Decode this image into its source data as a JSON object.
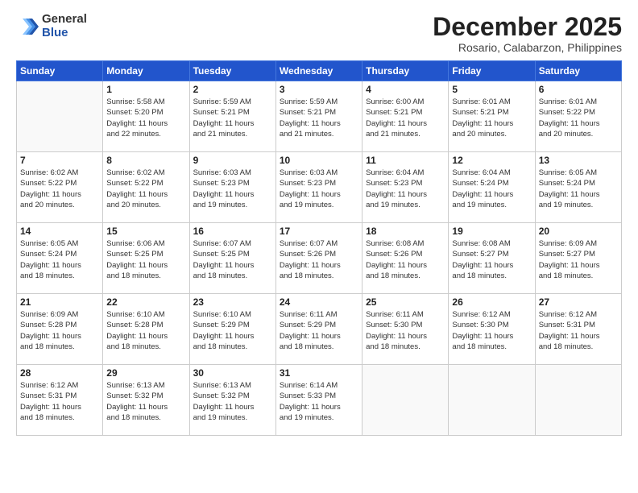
{
  "header": {
    "logo_general": "General",
    "logo_blue": "Blue",
    "month_title": "December 2025",
    "location": "Rosario, Calabarzon, Philippines"
  },
  "days_of_week": [
    "Sunday",
    "Monday",
    "Tuesday",
    "Wednesday",
    "Thursday",
    "Friday",
    "Saturday"
  ],
  "weeks": [
    [
      {
        "day": "",
        "content": ""
      },
      {
        "day": "1",
        "content": "Sunrise: 5:58 AM\nSunset: 5:20 PM\nDaylight: 11 hours\nand 22 minutes."
      },
      {
        "day": "2",
        "content": "Sunrise: 5:59 AM\nSunset: 5:21 PM\nDaylight: 11 hours\nand 21 minutes."
      },
      {
        "day": "3",
        "content": "Sunrise: 5:59 AM\nSunset: 5:21 PM\nDaylight: 11 hours\nand 21 minutes."
      },
      {
        "day": "4",
        "content": "Sunrise: 6:00 AM\nSunset: 5:21 PM\nDaylight: 11 hours\nand 21 minutes."
      },
      {
        "day": "5",
        "content": "Sunrise: 6:01 AM\nSunset: 5:21 PM\nDaylight: 11 hours\nand 20 minutes."
      },
      {
        "day": "6",
        "content": "Sunrise: 6:01 AM\nSunset: 5:22 PM\nDaylight: 11 hours\nand 20 minutes."
      }
    ],
    [
      {
        "day": "7",
        "content": "Sunrise: 6:02 AM\nSunset: 5:22 PM\nDaylight: 11 hours\nand 20 minutes."
      },
      {
        "day": "8",
        "content": "Sunrise: 6:02 AM\nSunset: 5:22 PM\nDaylight: 11 hours\nand 20 minutes."
      },
      {
        "day": "9",
        "content": "Sunrise: 6:03 AM\nSunset: 5:23 PM\nDaylight: 11 hours\nand 19 minutes."
      },
      {
        "day": "10",
        "content": "Sunrise: 6:03 AM\nSunset: 5:23 PM\nDaylight: 11 hours\nand 19 minutes."
      },
      {
        "day": "11",
        "content": "Sunrise: 6:04 AM\nSunset: 5:23 PM\nDaylight: 11 hours\nand 19 minutes."
      },
      {
        "day": "12",
        "content": "Sunrise: 6:04 AM\nSunset: 5:24 PM\nDaylight: 11 hours\nand 19 minutes."
      },
      {
        "day": "13",
        "content": "Sunrise: 6:05 AM\nSunset: 5:24 PM\nDaylight: 11 hours\nand 19 minutes."
      }
    ],
    [
      {
        "day": "14",
        "content": "Sunrise: 6:05 AM\nSunset: 5:24 PM\nDaylight: 11 hours\nand 18 minutes."
      },
      {
        "day": "15",
        "content": "Sunrise: 6:06 AM\nSunset: 5:25 PM\nDaylight: 11 hours\nand 18 minutes."
      },
      {
        "day": "16",
        "content": "Sunrise: 6:07 AM\nSunset: 5:25 PM\nDaylight: 11 hours\nand 18 minutes."
      },
      {
        "day": "17",
        "content": "Sunrise: 6:07 AM\nSunset: 5:26 PM\nDaylight: 11 hours\nand 18 minutes."
      },
      {
        "day": "18",
        "content": "Sunrise: 6:08 AM\nSunset: 5:26 PM\nDaylight: 11 hours\nand 18 minutes."
      },
      {
        "day": "19",
        "content": "Sunrise: 6:08 AM\nSunset: 5:27 PM\nDaylight: 11 hours\nand 18 minutes."
      },
      {
        "day": "20",
        "content": "Sunrise: 6:09 AM\nSunset: 5:27 PM\nDaylight: 11 hours\nand 18 minutes."
      }
    ],
    [
      {
        "day": "21",
        "content": "Sunrise: 6:09 AM\nSunset: 5:28 PM\nDaylight: 11 hours\nand 18 minutes."
      },
      {
        "day": "22",
        "content": "Sunrise: 6:10 AM\nSunset: 5:28 PM\nDaylight: 11 hours\nand 18 minutes."
      },
      {
        "day": "23",
        "content": "Sunrise: 6:10 AM\nSunset: 5:29 PM\nDaylight: 11 hours\nand 18 minutes."
      },
      {
        "day": "24",
        "content": "Sunrise: 6:11 AM\nSunset: 5:29 PM\nDaylight: 11 hours\nand 18 minutes."
      },
      {
        "day": "25",
        "content": "Sunrise: 6:11 AM\nSunset: 5:30 PM\nDaylight: 11 hours\nand 18 minutes."
      },
      {
        "day": "26",
        "content": "Sunrise: 6:12 AM\nSunset: 5:30 PM\nDaylight: 11 hours\nand 18 minutes."
      },
      {
        "day": "27",
        "content": "Sunrise: 6:12 AM\nSunset: 5:31 PM\nDaylight: 11 hours\nand 18 minutes."
      }
    ],
    [
      {
        "day": "28",
        "content": "Sunrise: 6:12 AM\nSunset: 5:31 PM\nDaylight: 11 hours\nand 18 minutes."
      },
      {
        "day": "29",
        "content": "Sunrise: 6:13 AM\nSunset: 5:32 PM\nDaylight: 11 hours\nand 18 minutes."
      },
      {
        "day": "30",
        "content": "Sunrise: 6:13 AM\nSunset: 5:32 PM\nDaylight: 11 hours\nand 19 minutes."
      },
      {
        "day": "31",
        "content": "Sunrise: 6:14 AM\nSunset: 5:33 PM\nDaylight: 11 hours\nand 19 minutes."
      },
      {
        "day": "",
        "content": ""
      },
      {
        "day": "",
        "content": ""
      },
      {
        "day": "",
        "content": ""
      }
    ]
  ]
}
